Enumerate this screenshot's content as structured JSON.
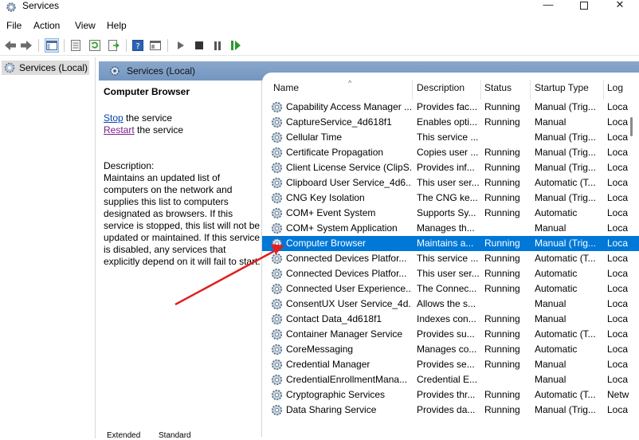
{
  "window": {
    "title": "Services"
  },
  "menu": [
    "File",
    "Action",
    "View",
    "Help"
  ],
  "tree": {
    "root_label": "Services (Local)"
  },
  "panel": {
    "header": "Services (Local)"
  },
  "details": {
    "service_name": "Computer Browser",
    "stop_link": "Stop",
    "stop_suffix": " the service",
    "restart_link": "Restart",
    "restart_suffix": " the service",
    "description_label": "Description:",
    "description": "Maintains an updated list of computers on the network and supplies this list to computers designated as browsers. If this service is stopped, this list will not be updated or maintained. If this service is disabled, any services that explicitly depend on it will fail to start."
  },
  "columns": [
    "Name",
    "Description",
    "Status",
    "Startup Type",
    "Log"
  ],
  "services": [
    {
      "name": "Capability Access Manager ...",
      "description": "Provides fac...",
      "status": "Running",
      "startup": "Manual (Trig...",
      "log": "Loca"
    },
    {
      "name": "CaptureService_4d618f1",
      "description": "Enables opti...",
      "status": "Running",
      "startup": "Manual",
      "log": "Loca"
    },
    {
      "name": "Cellular Time",
      "description": "This service ...",
      "status": "",
      "startup": "Manual (Trig...",
      "log": "Loca"
    },
    {
      "name": "Certificate Propagation",
      "description": "Copies user ...",
      "status": "Running",
      "startup": "Manual (Trig...",
      "log": "Loca"
    },
    {
      "name": "Client License Service (ClipS...",
      "description": "Provides inf...",
      "status": "Running",
      "startup": "Manual (Trig...",
      "log": "Loca"
    },
    {
      "name": "Clipboard User Service_4d6...",
      "description": "This user ser...",
      "status": "Running",
      "startup": "Automatic (T...",
      "log": "Loca"
    },
    {
      "name": "CNG Key Isolation",
      "description": "The CNG ke...",
      "status": "Running",
      "startup": "Manual (Trig...",
      "log": "Loca"
    },
    {
      "name": "COM+ Event System",
      "description": "Supports Sy...",
      "status": "Running",
      "startup": "Automatic",
      "log": "Loca"
    },
    {
      "name": "COM+ System Application",
      "description": "Manages th...",
      "status": "",
      "startup": "Manual",
      "log": "Loca"
    },
    {
      "name": "Computer Browser",
      "description": "Maintains a...",
      "status": "Running",
      "startup": "Manual (Trig...",
      "log": "Loca",
      "selected": true
    },
    {
      "name": "Connected Devices Platfor...",
      "description": "This service ...",
      "status": "Running",
      "startup": "Automatic (T...",
      "log": "Loca"
    },
    {
      "name": "Connected Devices Platfor...",
      "description": "This user ser...",
      "status": "Running",
      "startup": "Automatic",
      "log": "Loca"
    },
    {
      "name": "Connected User Experience...",
      "description": "The Connec...",
      "status": "Running",
      "startup": "Automatic",
      "log": "Loca"
    },
    {
      "name": "ConsentUX User Service_4d...",
      "description": "Allows the s...",
      "status": "",
      "startup": "Manual",
      "log": "Loca"
    },
    {
      "name": "Contact Data_4d618f1",
      "description": "Indexes con...",
      "status": "Running",
      "startup": "Manual",
      "log": "Loca"
    },
    {
      "name": "Container Manager Service",
      "description": "Provides su...",
      "status": "Running",
      "startup": "Automatic (T...",
      "log": "Loca"
    },
    {
      "name": "CoreMessaging",
      "description": "Manages co...",
      "status": "Running",
      "startup": "Automatic",
      "log": "Loca"
    },
    {
      "name": "Credential Manager",
      "description": "Provides se...",
      "status": "Running",
      "startup": "Manual",
      "log": "Loca"
    },
    {
      "name": "CredentialEnrollmentMana...",
      "description": "Credential E...",
      "status": "",
      "startup": "Manual",
      "log": "Loca"
    },
    {
      "name": "Cryptographic Services",
      "description": "Provides thr...",
      "status": "Running",
      "startup": "Automatic (T...",
      "log": "Netw"
    },
    {
      "name": "Data Sharing Service",
      "description": "Provides da...",
      "status": "Running",
      "startup": "Manual (Trig...",
      "log": "Loca"
    }
  ],
  "bottom_tabs": [
    "Extended",
    "Standard"
  ],
  "annotation": {
    "arrow_color": "#e02020"
  },
  "icons": [
    "gear-icon",
    "back-icon",
    "forward-icon",
    "console-tree-icon",
    "properties-icon",
    "refresh-icon",
    "export-icon",
    "help-icon",
    "view-icon",
    "play-icon",
    "stop-icon",
    "pause-icon",
    "restart-icon"
  ]
}
